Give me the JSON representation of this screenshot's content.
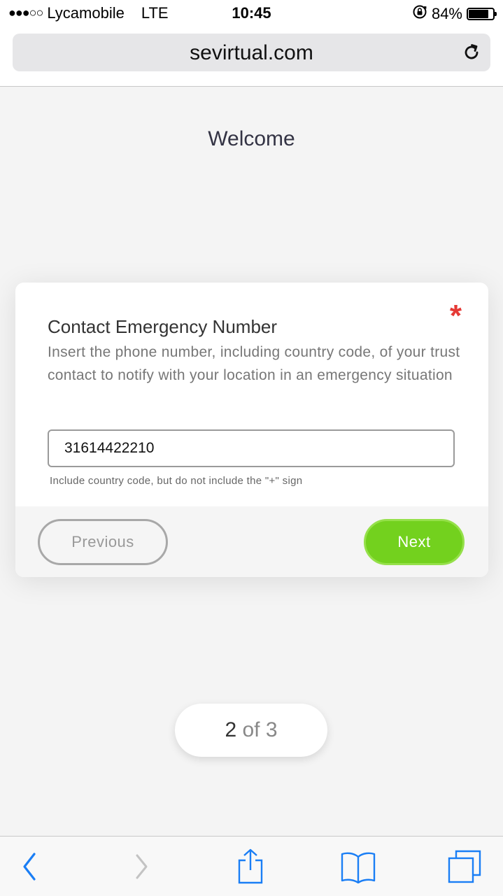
{
  "status_bar": {
    "signal": "●●●○○",
    "carrier": "Lycamobile",
    "network": "LTE",
    "time": "10:45",
    "battery": "84%",
    "battery_level": 0.84,
    "lock_rotation_icon": "orientation-lock-icon"
  },
  "browser": {
    "url": "sevirtual.com",
    "reload_icon": "reload-icon"
  },
  "page": {
    "welcome": "Welcome",
    "question": {
      "title": "Contact Emergency Number",
      "required_mark": "*",
      "description": "Insert the phone number, including country code, of your trust contact to notify with your location in an emergency situation",
      "input_value": "31614422210",
      "hint": "Include country code, but do not include the \"+\" sign"
    },
    "buttons": {
      "previous": "Previous",
      "next": "Next"
    },
    "pager": {
      "current": "2",
      "separator": " of ",
      "total": "3"
    }
  },
  "toolbar": {
    "items": [
      "back-icon",
      "forward-icon",
      "share-icon",
      "bookmarks-icon",
      "tabs-icon"
    ]
  },
  "colors": {
    "accent_green": "#73d11e",
    "required_red": "#e53935",
    "ios_blue": "#1a7ef5"
  }
}
